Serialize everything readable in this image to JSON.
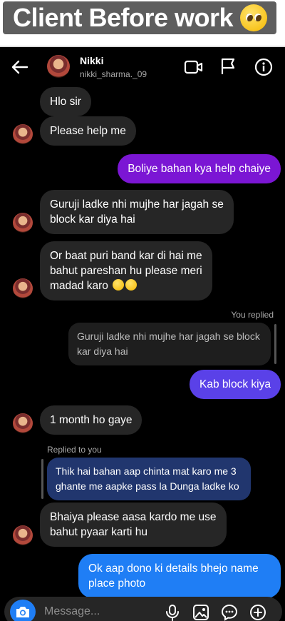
{
  "banner": {
    "title": "Client Before work",
    "emoji": "pleading-face-emoji"
  },
  "header": {
    "name": "Nikki",
    "handle": "nikki_sharma._09"
  },
  "messages": {
    "m1": "Hlo sir",
    "m2": "Please help me",
    "m3": "Boliye bahan kya help chaiye",
    "m4_l1": "Guruji ladke nhi mujhe har jagah se",
    "m4_l2": "block kar diya hai",
    "m5_l1": "Or baat puri band kar di hai me",
    "m5_l2": "bahut pareshan hu please meri",
    "m5_l3": "madad karo",
    "you_replied": "You replied",
    "quote_l1": "Guruji ladke nhi mujhe har jagah se block",
    "quote_l2": "kar diya hai",
    "m6": "Kab block kiya",
    "m7": "1 month ho gaye",
    "replied_to_you": "Replied to you",
    "reply_l1": "Thik hai bahan aap chinta mat karo me 3",
    "reply_l2": "ghante me aapke pass la Dunga ladke ko",
    "m8_l1": "Bhaiya please aasa kardo me use",
    "m8_l2": "bahut pyaar karti hu",
    "m9_l1": "Ok aap dono ki details bhejo name",
    "m9_l2": "place photo"
  },
  "composer": {
    "placeholder": "Message..."
  },
  "colors": {
    "background": "#000000",
    "incoming": "#262626",
    "outgoing_purple": "#7b16d4",
    "outgoing_violet": "#5a41e8",
    "outgoing_blue": "#1f7ef5",
    "reply_quote": "#21366e"
  },
  "icons": [
    "back-arrow-icon",
    "video-call-icon",
    "flag-icon",
    "info-icon",
    "camera-icon",
    "microphone-icon",
    "gallery-icon",
    "sticker-icon",
    "plus-icon"
  ]
}
